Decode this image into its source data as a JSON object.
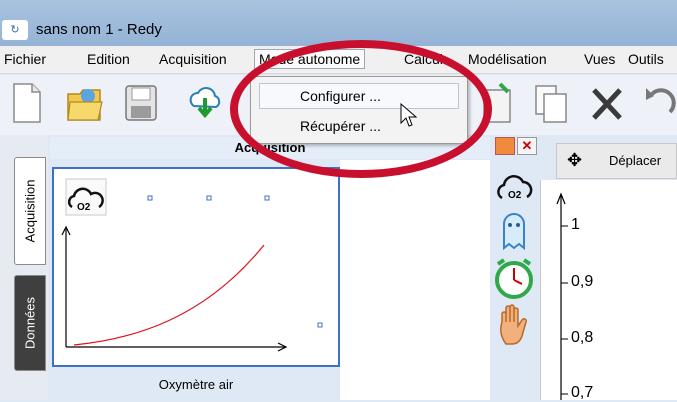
{
  "window": {
    "title": "sans nom 1 - Redy"
  },
  "menubar": {
    "items": [
      "Fichier",
      "Edition",
      "Acquisition",
      "Mode autonome",
      "Calcul",
      "Modélisation",
      "Vues",
      "Outils"
    ]
  },
  "dropdown": {
    "items": [
      "Configurer ...",
      "Récupérer ..."
    ]
  },
  "tabs": [
    "Acquisition",
    "Données"
  ],
  "panel": {
    "header": "Acquisition",
    "sensor_label": "Oxymètre air",
    "sensor_icon_text": "O2"
  },
  "right_toolbar": {
    "move_label": "Déplacer"
  },
  "axis": {
    "ticks": [
      "1",
      "0,9",
      "0,8",
      "0,7"
    ]
  },
  "colors": {
    "highlight": "#c8102e",
    "plot_border": "#3d71c5",
    "curve": "#e0121e"
  },
  "icons": [
    "new-document-icon",
    "open-folder-icon",
    "save-icon",
    "cloud-download-icon",
    "paste-icon",
    "copy-icon",
    "delete-icon",
    "undo-icon",
    "o2-cloud-icon",
    "ghost-icon",
    "clock-icon",
    "hand-icon",
    "move-icon"
  ]
}
